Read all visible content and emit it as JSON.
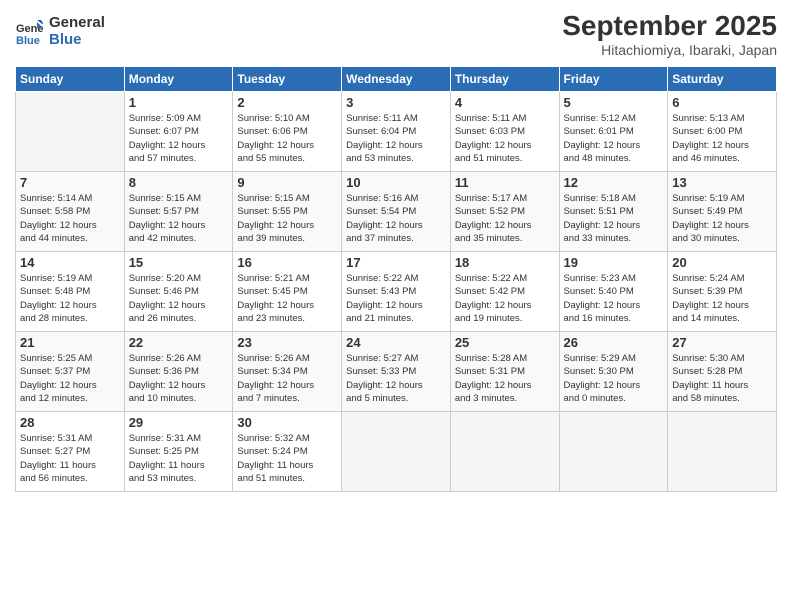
{
  "logo": {
    "line1": "General",
    "line2": "Blue"
  },
  "title": "September 2025",
  "subtitle": "Hitachiomiya, Ibaraki, Japan",
  "headers": [
    "Sunday",
    "Monday",
    "Tuesday",
    "Wednesday",
    "Thursday",
    "Friday",
    "Saturday"
  ],
  "weeks": [
    [
      {
        "num": "",
        "info": ""
      },
      {
        "num": "1",
        "info": "Sunrise: 5:09 AM\nSunset: 6:07 PM\nDaylight: 12 hours\nand 57 minutes."
      },
      {
        "num": "2",
        "info": "Sunrise: 5:10 AM\nSunset: 6:06 PM\nDaylight: 12 hours\nand 55 minutes."
      },
      {
        "num": "3",
        "info": "Sunrise: 5:11 AM\nSunset: 6:04 PM\nDaylight: 12 hours\nand 53 minutes."
      },
      {
        "num": "4",
        "info": "Sunrise: 5:11 AM\nSunset: 6:03 PM\nDaylight: 12 hours\nand 51 minutes."
      },
      {
        "num": "5",
        "info": "Sunrise: 5:12 AM\nSunset: 6:01 PM\nDaylight: 12 hours\nand 48 minutes."
      },
      {
        "num": "6",
        "info": "Sunrise: 5:13 AM\nSunset: 6:00 PM\nDaylight: 12 hours\nand 46 minutes."
      }
    ],
    [
      {
        "num": "7",
        "info": "Sunrise: 5:14 AM\nSunset: 5:58 PM\nDaylight: 12 hours\nand 44 minutes."
      },
      {
        "num": "8",
        "info": "Sunrise: 5:15 AM\nSunset: 5:57 PM\nDaylight: 12 hours\nand 42 minutes."
      },
      {
        "num": "9",
        "info": "Sunrise: 5:15 AM\nSunset: 5:55 PM\nDaylight: 12 hours\nand 39 minutes."
      },
      {
        "num": "10",
        "info": "Sunrise: 5:16 AM\nSunset: 5:54 PM\nDaylight: 12 hours\nand 37 minutes."
      },
      {
        "num": "11",
        "info": "Sunrise: 5:17 AM\nSunset: 5:52 PM\nDaylight: 12 hours\nand 35 minutes."
      },
      {
        "num": "12",
        "info": "Sunrise: 5:18 AM\nSunset: 5:51 PM\nDaylight: 12 hours\nand 33 minutes."
      },
      {
        "num": "13",
        "info": "Sunrise: 5:19 AM\nSunset: 5:49 PM\nDaylight: 12 hours\nand 30 minutes."
      }
    ],
    [
      {
        "num": "14",
        "info": "Sunrise: 5:19 AM\nSunset: 5:48 PM\nDaylight: 12 hours\nand 28 minutes."
      },
      {
        "num": "15",
        "info": "Sunrise: 5:20 AM\nSunset: 5:46 PM\nDaylight: 12 hours\nand 26 minutes."
      },
      {
        "num": "16",
        "info": "Sunrise: 5:21 AM\nSunset: 5:45 PM\nDaylight: 12 hours\nand 23 minutes."
      },
      {
        "num": "17",
        "info": "Sunrise: 5:22 AM\nSunset: 5:43 PM\nDaylight: 12 hours\nand 21 minutes."
      },
      {
        "num": "18",
        "info": "Sunrise: 5:22 AM\nSunset: 5:42 PM\nDaylight: 12 hours\nand 19 minutes."
      },
      {
        "num": "19",
        "info": "Sunrise: 5:23 AM\nSunset: 5:40 PM\nDaylight: 12 hours\nand 16 minutes."
      },
      {
        "num": "20",
        "info": "Sunrise: 5:24 AM\nSunset: 5:39 PM\nDaylight: 12 hours\nand 14 minutes."
      }
    ],
    [
      {
        "num": "21",
        "info": "Sunrise: 5:25 AM\nSunset: 5:37 PM\nDaylight: 12 hours\nand 12 minutes."
      },
      {
        "num": "22",
        "info": "Sunrise: 5:26 AM\nSunset: 5:36 PM\nDaylight: 12 hours\nand 10 minutes."
      },
      {
        "num": "23",
        "info": "Sunrise: 5:26 AM\nSunset: 5:34 PM\nDaylight: 12 hours\nand 7 minutes."
      },
      {
        "num": "24",
        "info": "Sunrise: 5:27 AM\nSunset: 5:33 PM\nDaylight: 12 hours\nand 5 minutes."
      },
      {
        "num": "25",
        "info": "Sunrise: 5:28 AM\nSunset: 5:31 PM\nDaylight: 12 hours\nand 3 minutes."
      },
      {
        "num": "26",
        "info": "Sunrise: 5:29 AM\nSunset: 5:30 PM\nDaylight: 12 hours\nand 0 minutes."
      },
      {
        "num": "27",
        "info": "Sunrise: 5:30 AM\nSunset: 5:28 PM\nDaylight: 11 hours\nand 58 minutes."
      }
    ],
    [
      {
        "num": "28",
        "info": "Sunrise: 5:31 AM\nSunset: 5:27 PM\nDaylight: 11 hours\nand 56 minutes."
      },
      {
        "num": "29",
        "info": "Sunrise: 5:31 AM\nSunset: 5:25 PM\nDaylight: 11 hours\nand 53 minutes."
      },
      {
        "num": "30",
        "info": "Sunrise: 5:32 AM\nSunset: 5:24 PM\nDaylight: 11 hours\nand 51 minutes."
      },
      {
        "num": "",
        "info": ""
      },
      {
        "num": "",
        "info": ""
      },
      {
        "num": "",
        "info": ""
      },
      {
        "num": "",
        "info": ""
      }
    ]
  ]
}
